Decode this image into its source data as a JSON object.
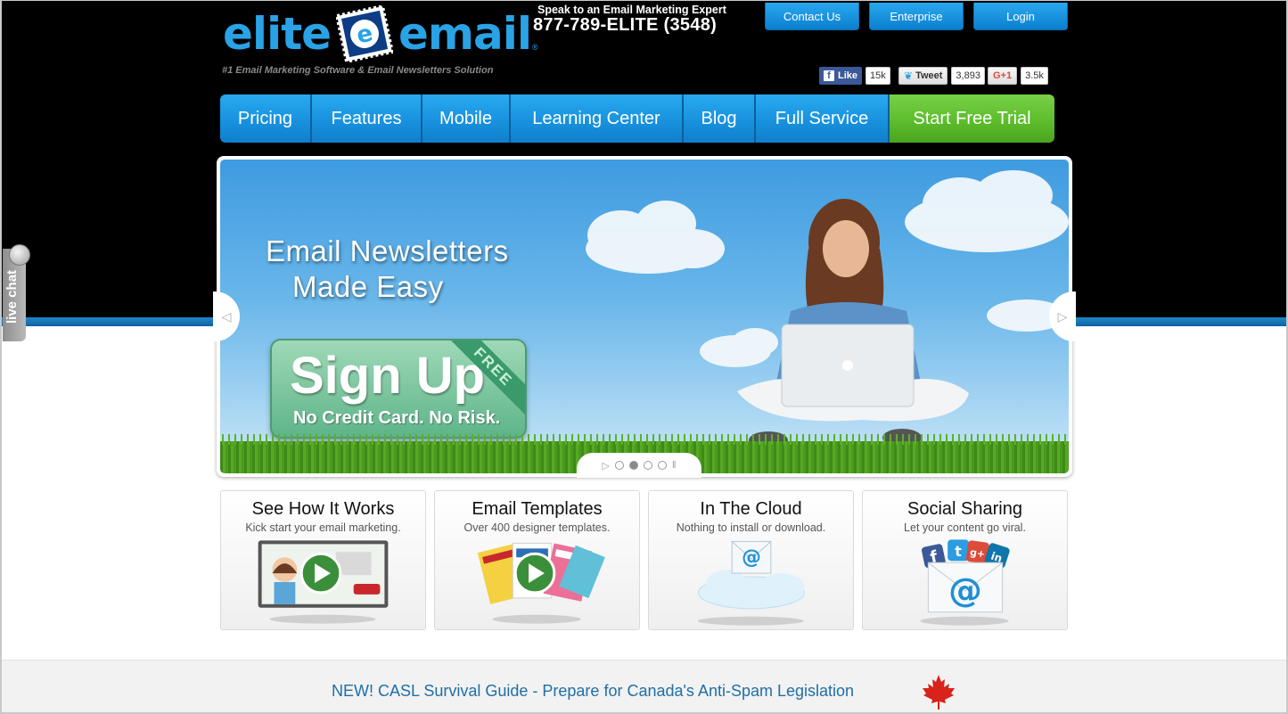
{
  "header": {
    "logo_left": "elite",
    "logo_right": "email",
    "logo_reg": "®",
    "tagline": "#1 Email Marketing Software & Email Newsletters Solution",
    "phone_label": "Speak to an Email Marketing Expert",
    "phone_number": "877-789-ELITE (3548)",
    "top_buttons": [
      "Contact Us",
      "Enterprise",
      "Login"
    ]
  },
  "social": {
    "facebook": {
      "label": "Like",
      "count": "15k",
      "icon": "facebook-icon",
      "color": "#3b5998"
    },
    "twitter": {
      "label": "Tweet",
      "count": "3,893",
      "icon": "twitter-bird-icon",
      "color": "#2b9de2"
    },
    "google": {
      "label": "G+1",
      "count": "3.5k",
      "icon": "google-plus-icon",
      "color": "#dd4b39"
    }
  },
  "nav": {
    "items": [
      "Pricing",
      "Features",
      "Mobile",
      "Learning Center",
      "Blog",
      "Full Service"
    ],
    "cta": "Start Free Trial"
  },
  "hero": {
    "headline_line1": "Email Newsletters",
    "headline_line2": "Made Easy",
    "signup_big": "Sign Up",
    "signup_small": "No Credit Card.  No Risk.",
    "ribbon": "FREE",
    "slides": 4,
    "active_slide": 1
  },
  "livechat": {
    "label": "live chat"
  },
  "cards": [
    {
      "title": "See How It Works",
      "subtitle": "Kick start your email marketing."
    },
    {
      "title": "Email Templates",
      "subtitle": "Over 400 designer templates."
    },
    {
      "title": "In The Cloud",
      "subtitle": "Nothing to install or download."
    },
    {
      "title": "Social Sharing",
      "subtitle": "Let your content go viral."
    }
  ],
  "footer": {
    "casl_link": "NEW! CASL Survival Guide - Prepare for Canada's Anti-Spam Legislation"
  },
  "colors": {
    "brand_blue": "#29a3e6",
    "nav_blue": "#1a94e0",
    "cta_green": "#5dbd2c",
    "link_blue": "#1e6fa8"
  }
}
